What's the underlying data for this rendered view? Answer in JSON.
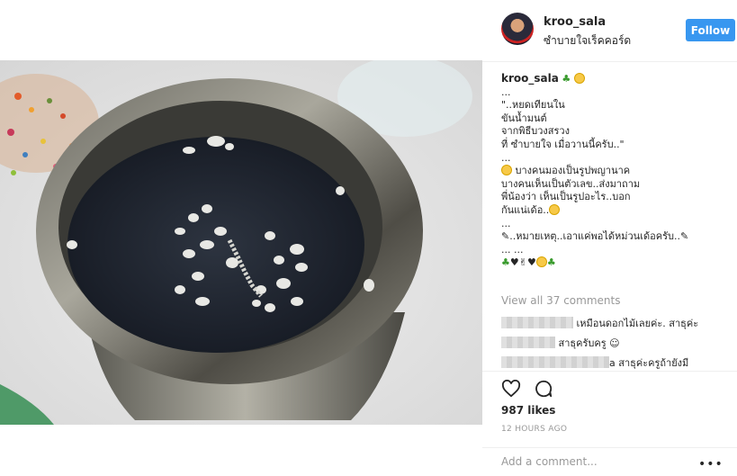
{
  "post": {
    "username": "kroo_sala",
    "location": "ซำบายใจเร็คคอร์ด",
    "follow_label": "Follow"
  },
  "caption": {
    "username": "kroo_sala",
    "lines": [
      "...",
      "\"..หยดเทียนใน",
      "ขันน้ำมนต์",
      "จากพิธีบวงสรวง",
      "ที่ ซำบายใจ เมื่อวานนี้ครับ..\"",
      "...",
      "บางคนมองเป็นรูปพญานาค",
      "บางคนเห็นเป็นตัวเลข..ส่งมาถาม",
      "พี่น้องว่า เห็นเป็นรูปอะไร..บอก",
      "กันแน่เด้อ..",
      "...",
      "..หมายเหตุ..เอาแค่พอได้หม่วนเด้อครับ..",
      "... ..."
    ]
  },
  "view_all_comments": "View all 37 comments",
  "comments": [
    {
      "username_hidden": true,
      "text": "เหมือนดอกไม้เลยค่ะ. สาธุค่ะ"
    },
    {
      "username_hidden": true,
      "text": "สาธุครับครู"
    },
    {
      "username_hidden": true,
      "username_tail": "a",
      "text": "สาธุค่ะครูถ้ายังมี"
    }
  ],
  "likes": "987 likes",
  "time_ago": "12 HOURS AGO",
  "add_comment_placeholder": "Add a comment...",
  "icons": {
    "like": "heart-outline-icon",
    "comment": "speech-bubble-icon",
    "more": "ellipsis-icon"
  },
  "colors": {
    "follow_button": "#3897f0",
    "muted_text": "#999999",
    "divider": "#efefef"
  }
}
